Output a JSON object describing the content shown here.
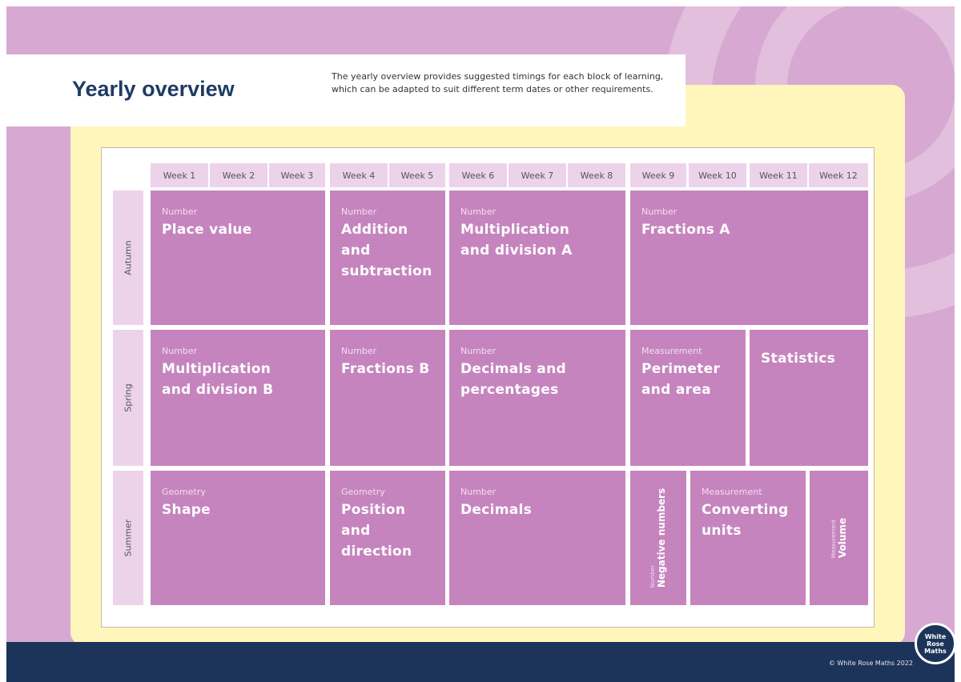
{
  "header": {
    "title": "Yearly overview",
    "description": "The yearly overview provides suggested timings for each block of learning, which can be adapted to suit different term dates or other requirements."
  },
  "weeks": [
    "Week 1",
    "Week 2",
    "Week 3",
    "Week 4",
    "Week 5",
    "Week 6",
    "Week 7",
    "Week 8",
    "Week 9",
    "Week 10",
    "Week 11",
    "Week 12"
  ],
  "terms": [
    "Autumn",
    "Spring",
    "Summer"
  ],
  "autumn": [
    {
      "category": "Number",
      "name": "Place value"
    },
    {
      "category": "Number",
      "name": "Addition and subtraction"
    },
    {
      "category": "Number",
      "name": "Multiplication and division A"
    },
    {
      "category": "Number",
      "name": "Fractions A"
    }
  ],
  "spring": [
    {
      "category": "Number",
      "name": "Multiplication and division B"
    },
    {
      "category": "Number",
      "name": "Fractions B"
    },
    {
      "category": "Number",
      "name": "Decimals and percentages"
    },
    {
      "category": "Measurement",
      "name": "Perimeter and area"
    },
    {
      "category": "",
      "name": "Statistics"
    }
  ],
  "summer": [
    {
      "category": "Geometry",
      "name": "Shape"
    },
    {
      "category": "Geometry",
      "name": "Position and direction"
    },
    {
      "category": "Number",
      "name": "Decimals"
    },
    {
      "category": "Number",
      "name": "Negative numbers"
    },
    {
      "category": "Measurement",
      "name": "Converting units"
    },
    {
      "category": "Measurement",
      "name": "Volume"
    }
  ],
  "footer": {
    "copyright": "© White Rose Maths 2022",
    "logo_lines": [
      "White",
      "Rose",
      "Maths"
    ]
  },
  "colors": {
    "background": "#d7a9d2",
    "panel": "#fff6bb",
    "block": "#c684bf",
    "header_cell": "#ecd3ea",
    "footer": "#1c3459",
    "title": "#1f3b64"
  }
}
